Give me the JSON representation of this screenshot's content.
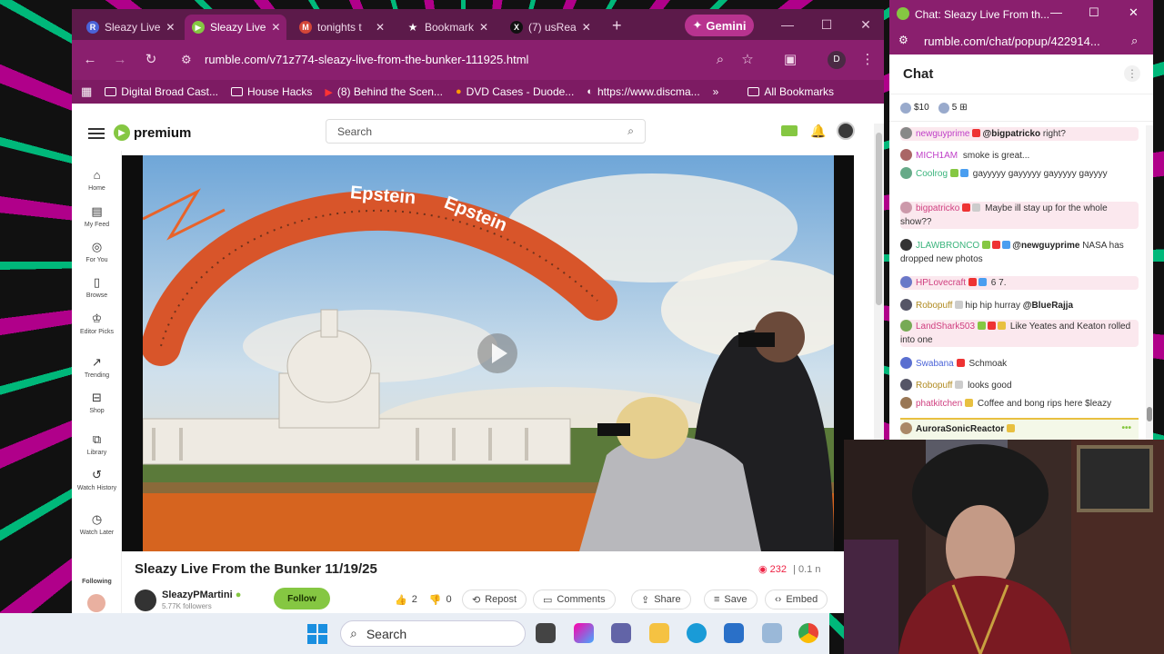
{
  "tabs": [
    {
      "label": "Sleazy Live",
      "icon": "R",
      "color": "#4a63d8"
    },
    {
      "label": "Sleazy Live",
      "icon": "▶",
      "color": "#85c742"
    },
    {
      "label": "tonights t",
      "icon": "M",
      "color": "#d44638"
    },
    {
      "label": "Bookmark",
      "icon": "★",
      "color": "#555"
    },
    {
      "label": "(7) usRea",
      "icon": "X",
      "color": "#111"
    }
  ],
  "gemini_label": "Gemini",
  "address": "rumble.com/v71z774-sleazy-live-from-the-bunker-111925.html",
  "profile_initial": "D",
  "bookmarks": [
    "Digital Broad Cast...",
    "House Hacks",
    "(8) Behind the Scen...",
    "DVD Cases - Duode...",
    "https://www.discma..."
  ],
  "bookmarks_more": "»",
  "all_bookmarks": "All Bookmarks",
  "rumble": {
    "logo_text": "premium",
    "search_placeholder": "Search",
    "nav": [
      "Home",
      "My Feed",
      "For You",
      "Browse",
      "Editor Picks",
      "Trending",
      "Shop",
      "Library",
      "Watch History",
      "Watch Later"
    ],
    "following_label": "Following",
    "artwork_text_1": "Epstein",
    "artwork_text_2": "Epstein",
    "video_title": "Sleazy Live From the Bunker 11/19/25",
    "views": "232",
    "views_suffix": "| 0.1 n",
    "channel_name": "SleazyPMartini",
    "followers": "5.77K followers",
    "follow_label": "Follow",
    "likes": "2",
    "dislikes": "0",
    "repost": "Repost",
    "comments": "Comments",
    "share": "Share",
    "save": "Save",
    "embed": "Embed"
  },
  "chat": {
    "window_title": "Chat: Sleazy Live From th...",
    "url": "rumble.com/chat/popup/422914...",
    "heading": "Chat",
    "rants": [
      {
        "amount": "$10"
      },
      {
        "amount": "5"
      }
    ],
    "messages": [
      {
        "user": "newguyprime",
        "color": "#c040c8",
        "mention": "@bigpatricko",
        "text": " right?",
        "hl": true
      },
      {
        "user": "MICH1AM",
        "color": "#c040c8",
        "mention": "",
        "text": " smoke is great...",
        "hl": false
      },
      {
        "user": "Coolrog",
        "color": "#3ab47c",
        "mention": "",
        "text": " gayyyyy gayyyyy gayyyyy gayyyy",
        "hl": false
      },
      {
        "user": "bigpatricko",
        "color": "#d04080",
        "mention": "",
        "text": " Maybe ill stay up for the whole show??",
        "hl": true
      },
      {
        "user": "JLAWBRONCO",
        "color": "#3ab47c",
        "mention": "@newguyprime",
        "text": " NASA has dropped new photos",
        "hl": false
      },
      {
        "user": "HPLovecraft",
        "color": "#d04080",
        "mention": "",
        "text": " 6 7.",
        "hl": true
      },
      {
        "user": "Robopuff",
        "color": "#b08a20",
        "mention": "@BlueRajja",
        "text": "hip hip hurray ",
        "hl": false
      },
      {
        "user": "LandShark503",
        "color": "#d04080",
        "mention": "",
        "text": " Like Yeates and Keaton rolled into one",
        "hl": true
      },
      {
        "user": "Swabana",
        "color": "#4a63d8",
        "mention": "",
        "text": " Schmoak",
        "hl": false
      },
      {
        "user": "Robopuff",
        "color": "#b08a20",
        "mention": "",
        "text": " looks good",
        "hl": false
      },
      {
        "user": "phatkitchen",
        "color": "#d04080",
        "mention": "",
        "text": " Coffee and bong rips here $leazy",
        "hl": false
      },
      {
        "user": "AuroraSonicReactor",
        "color": "#222",
        "mention": "",
        "text": "",
        "hl": false
      }
    ]
  },
  "taskbar": {
    "search_label": "Search"
  },
  "colors": {
    "chrome_dark": "#5c1a4a",
    "chrome": "#8a1f6e",
    "rumble_green": "#85c742"
  }
}
